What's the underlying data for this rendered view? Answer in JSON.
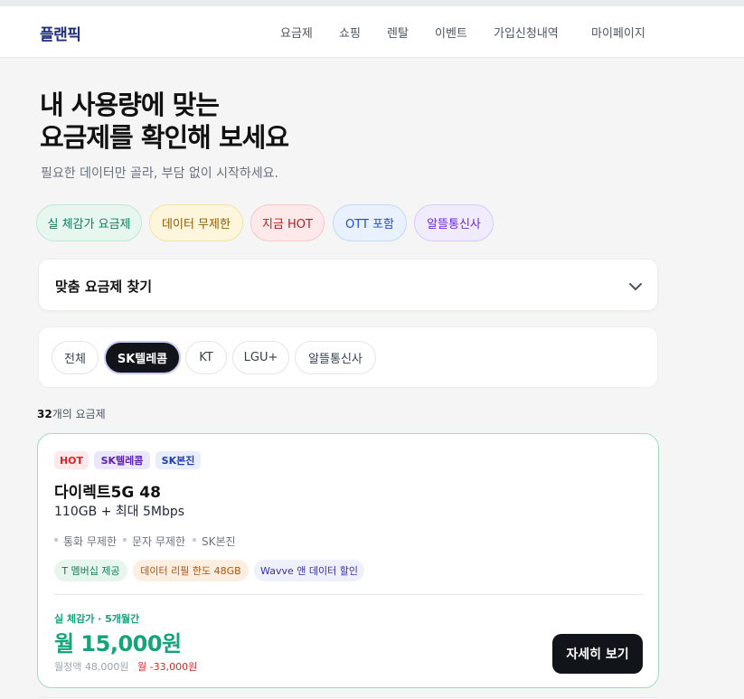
{
  "header": {
    "logo": "플랜픽",
    "nav": [
      "요금제",
      "쇼핑",
      "렌탈",
      "이벤트",
      "가입신청내역",
      "마이페이지"
    ]
  },
  "hero": {
    "title_line1": "내 사용량에 맞는",
    "title_line2": "요금제를 확인해 보세요",
    "subtitle": "필요한 데이터만 골라, 부담 없이 시작하세요."
  },
  "quick_chips": [
    {
      "label": "실 체감가 요금제",
      "color": "#0f7a5a"
    },
    {
      "label": "데이터 무제한",
      "color": "#8a5a00"
    },
    {
      "label": "지금 HOT",
      "color": "#b91c1c"
    },
    {
      "label": "OTT 포함",
      "color": "#1d4ed8"
    },
    {
      "label": "알뜰통신사",
      "color": "#6d28d9"
    }
  ],
  "finder": {
    "title": "맞춤 요금제 찾기",
    "icon": "chevron-down-icon"
  },
  "carriers": {
    "items": [
      "전체",
      "SK텔레콤",
      "KT",
      "LGU+",
      "알뜰통신사"
    ],
    "selected": "SK텔레콤"
  },
  "results": {
    "count": "32",
    "count_suffix": "개의 요금제"
  },
  "plan": {
    "tags": [
      "HOT",
      "SK텔레콤",
      "SK본진"
    ],
    "name": "다이렉트5G 48",
    "data": "110GB + 최대 5Mbps",
    "features": [
      "통화 무제한",
      "문자 무제한",
      "SK본진"
    ],
    "benefits": [
      "T 멤버십 제공",
      "데이터 리필 한도 48GB",
      "Wavve 앤 데이터 할인"
    ],
    "price_caption": "실 체감가 · 5개월간",
    "price": "월 15,000원",
    "original": "월정액 48,000원",
    "discount": "월 -33,000원",
    "detail_button": "자세히 보기"
  }
}
